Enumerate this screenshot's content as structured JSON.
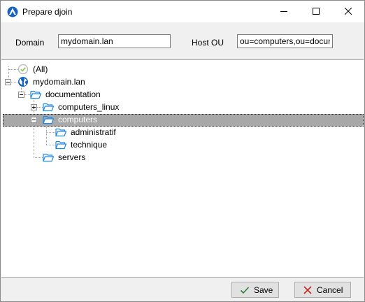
{
  "window": {
    "title": "Prepare djoin"
  },
  "form": {
    "domain_label": "Domain",
    "domain_value": "mydomain.lan",
    "host_ou_label": "Host OU",
    "host_ou_value": "ou=computers,ou=documentation,dc=mydomain,dc=lan"
  },
  "tree": {
    "all_label": "(All)",
    "domain": "mydomain.lan",
    "documentation": "documentation",
    "computers_linux": "computers_linux",
    "computers": "computers",
    "administratif": "administratif",
    "technique": "technique",
    "servers": "servers",
    "selected": "computers"
  },
  "buttons": {
    "save": "Save",
    "cancel": "Cancel"
  },
  "colors": {
    "folder": "#1e88e5",
    "globe": "#1565c0",
    "selection": "#a8a8a8",
    "save_check": "#2e7d32",
    "cancel_x": "#c62828",
    "all_check": "#8bc34a"
  },
  "icons": {
    "app": "app-logo-icon",
    "minimize": "minimize-icon",
    "maximize": "maximize-icon",
    "close": "close-icon",
    "all": "check-circle-icon",
    "domain": "globe-icon",
    "folder": "folder-open-icon",
    "save": "checkmark-icon",
    "cancel": "x-icon"
  }
}
